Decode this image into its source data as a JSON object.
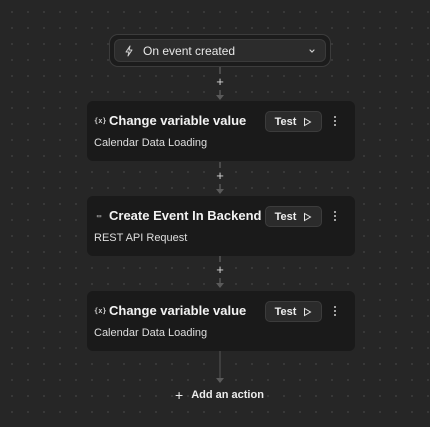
{
  "trigger": {
    "label": "On event created",
    "icon": "bolt-icon",
    "dropdown_icon": "chevron-down-icon"
  },
  "add_step_symbol": "+",
  "steps": [
    {
      "type_icon": "{x}",
      "icon_name": "variable-icon",
      "title": "Change variable value",
      "subtitle": "Calendar Data Loading",
      "test_label": "Test"
    },
    {
      "type_icon": "▭",
      "icon_name": "folder-icon",
      "title": "Create Event In Backend",
      "subtitle": "REST API Request",
      "test_label": "Test"
    },
    {
      "type_icon": "{x}",
      "icon_name": "variable-icon",
      "title": "Change variable value",
      "subtitle": "Calendar Data Loading",
      "test_label": "Test"
    }
  ],
  "add_action": {
    "symbol": "+",
    "label": "Add an action"
  },
  "colors": {
    "canvas": "#262626",
    "card": "#1a1a1a",
    "button": "#2b2b2b",
    "text": "#ececec"
  }
}
